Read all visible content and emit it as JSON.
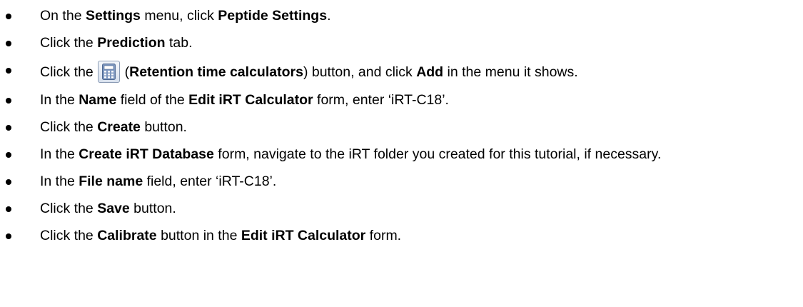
{
  "steps": [
    {
      "t1": "On the ",
      "b1": "Settings",
      "t2": " menu, click ",
      "b2": "Peptide Settings",
      "t3": "."
    },
    {
      "t1": "Click the ",
      "b1": "Prediction",
      "t2": " tab."
    },
    {
      "t1": "Click the ",
      "t2": " (",
      "b1": "Retention time calculators",
      "t3": ") button, and click ",
      "b2": "Add",
      "t4": " in the menu it shows."
    },
    {
      "t1": "In the ",
      "b1": "Name",
      "t2": " field of the ",
      "b2": "Edit iRT Calculator",
      "t3": " form, enter ‘iRT-C18’."
    },
    {
      "t1": "Click the ",
      "b1": "Create",
      "t2": " button."
    },
    {
      "t1": "In the ",
      "b1": "Create iRT Database",
      "t2": " form, navigate to the iRT folder you created for this tutorial, if necessary."
    },
    {
      "t1": "In the ",
      "b1": "File name",
      "t2": " field, enter ‘iRT-C18’."
    },
    {
      "t1": "Click the ",
      "b1": "Save",
      "t2": " button."
    },
    {
      "t1": "Click the ",
      "b1": "Calibrate",
      "t2": " button in the ",
      "b2": "Edit iRT Calculator",
      "t3": " form."
    }
  ],
  "icon": {
    "name": "calculator-icon",
    "body_color": "#7d97bf",
    "screen_color": "#ffffff"
  }
}
